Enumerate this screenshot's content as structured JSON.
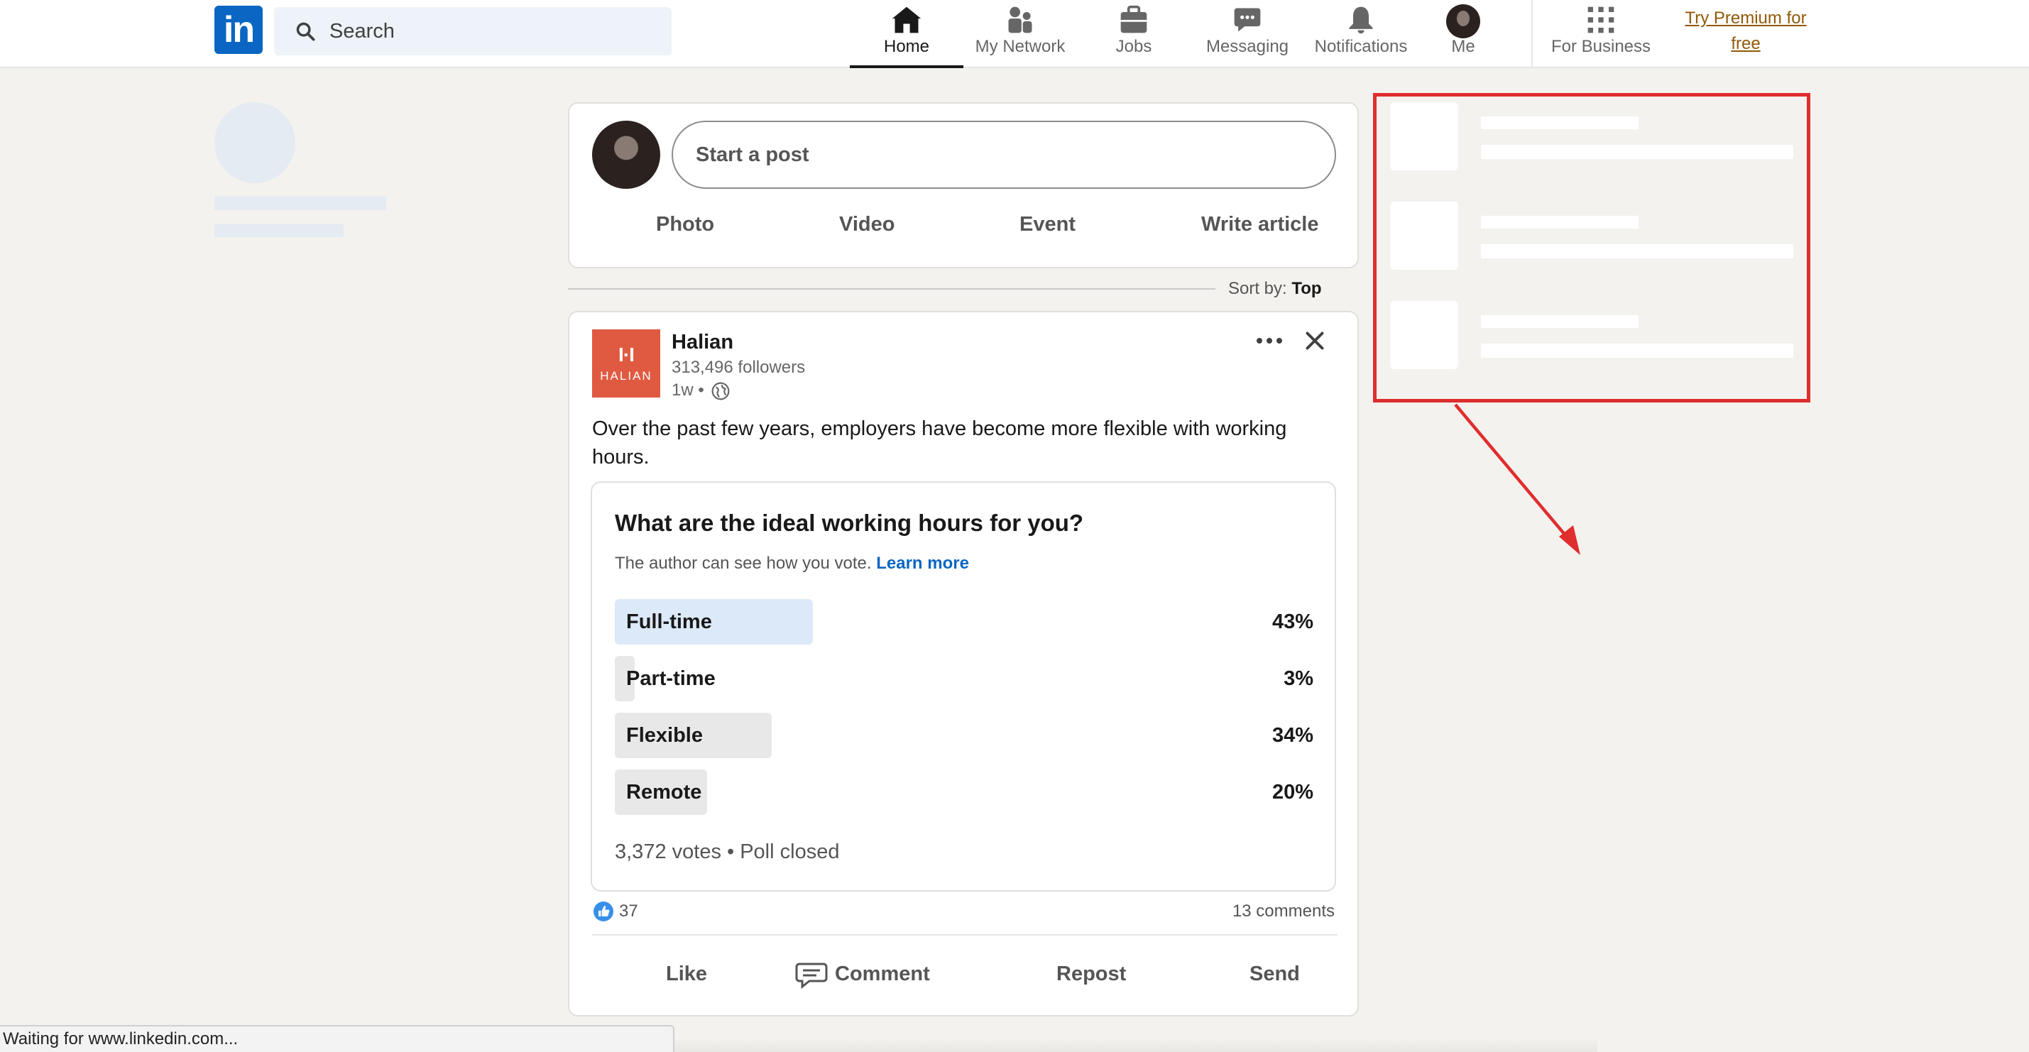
{
  "nav": {
    "logo_text": "in",
    "search_placeholder": "Search",
    "items": [
      {
        "label": "Home",
        "icon": "home-icon",
        "active": true
      },
      {
        "label": "My Network",
        "icon": "people-icon"
      },
      {
        "label": "Jobs",
        "icon": "briefcase-icon"
      },
      {
        "label": "Messaging",
        "icon": "chat-icon"
      },
      {
        "label": "Notifications",
        "icon": "bell-icon"
      },
      {
        "label": "Me",
        "icon": "avatar"
      },
      {
        "label": "For Business",
        "icon": "grid-icon"
      }
    ],
    "premium_line1": "Try Premium for",
    "premium_line2": "free"
  },
  "share": {
    "start_post": "Start a post",
    "actions": [
      "Photo",
      "Video",
      "Event",
      "Write article"
    ]
  },
  "sort": {
    "label": "Sort by:",
    "value": "Top"
  },
  "post": {
    "company": "Halian",
    "logo_text": "HALIAN",
    "followers": "313,496 followers",
    "time": "1w •",
    "text": "Over the past few years, employers have become more flexible with working hours.",
    "poll": {
      "question": "What are the ideal working hours for you?",
      "note": "The author can see how you vote.",
      "learn_more": "Learn more",
      "options": [
        {
          "label": "Full-time",
          "pct": "43%",
          "value": 43
        },
        {
          "label": "Part-time",
          "pct": "3%",
          "value": 3
        },
        {
          "label": "Flexible",
          "pct": "34%",
          "value": 34
        },
        {
          "label": "Remote",
          "pct": "20%",
          "value": 20
        }
      ],
      "votes": "3,372 votes • Poll closed"
    },
    "reactions": "37",
    "comments": "13 comments",
    "actions": [
      "Like",
      "Comment",
      "Repost",
      "Send"
    ]
  },
  "statusbar": "Waiting for www.linkedin.com...",
  "colors": {
    "brand": "#0a66c2",
    "annotation": "#e02d2d",
    "premium": "#915907"
  }
}
